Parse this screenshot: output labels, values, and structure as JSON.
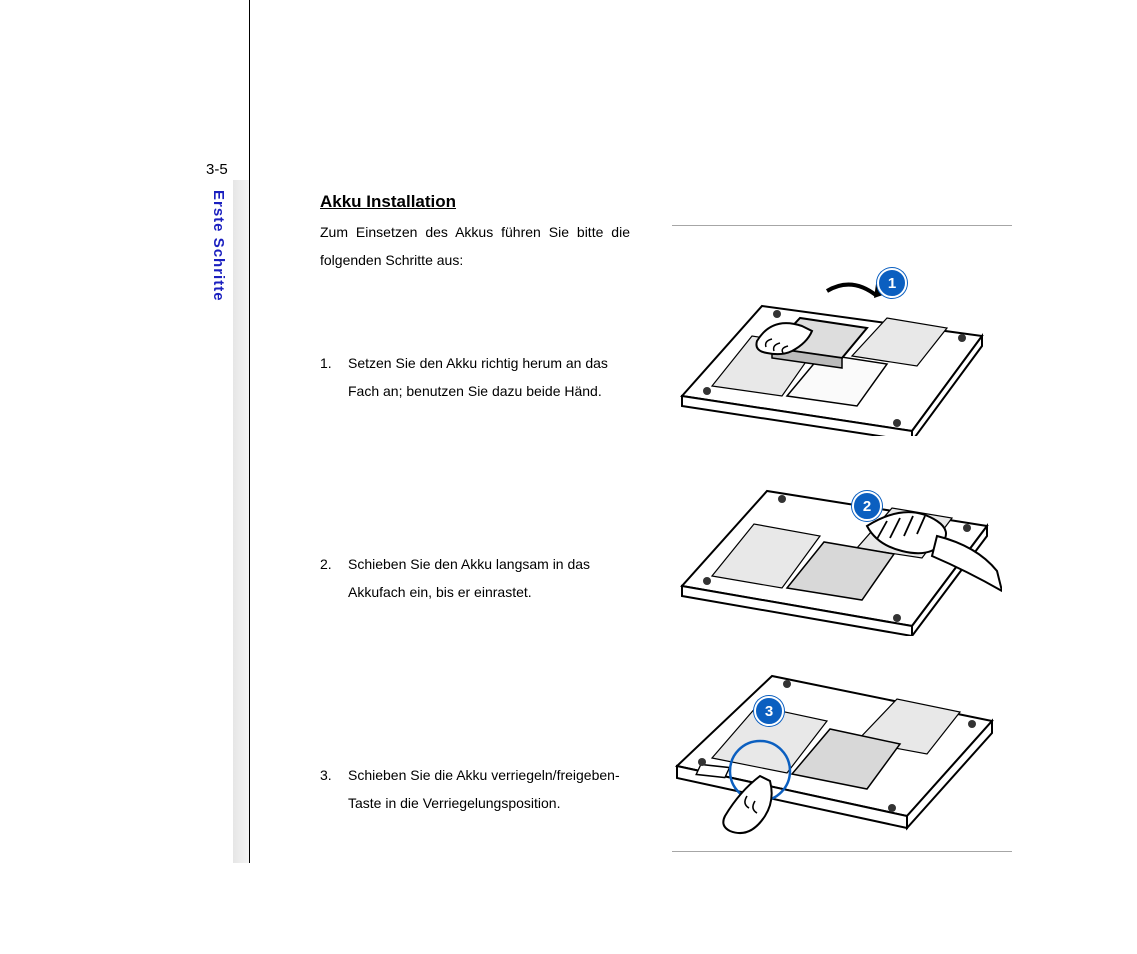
{
  "page_number": "3-5",
  "side_title": "Erste Schritte",
  "heading": "Akku Installation",
  "intro": "Zum Einsetzen des Akkus führen Sie bitte die folgenden Schritte aus:",
  "steps": [
    {
      "n": "1.",
      "text": "Setzen Sie den Akku richtig herum an das Fach an; benutzen Sie dazu beide Händ.",
      "badge": "1"
    },
    {
      "n": "2.",
      "text": "Schieben Sie den Akku langsam in das Akkufach ein, bis er einrastet.",
      "badge": "2"
    },
    {
      "n": "3.",
      "text": "Schieben Sie die Akku verriegeln/freigeben-Taste in die Verriegelungsposition.",
      "badge": "3"
    }
  ]
}
